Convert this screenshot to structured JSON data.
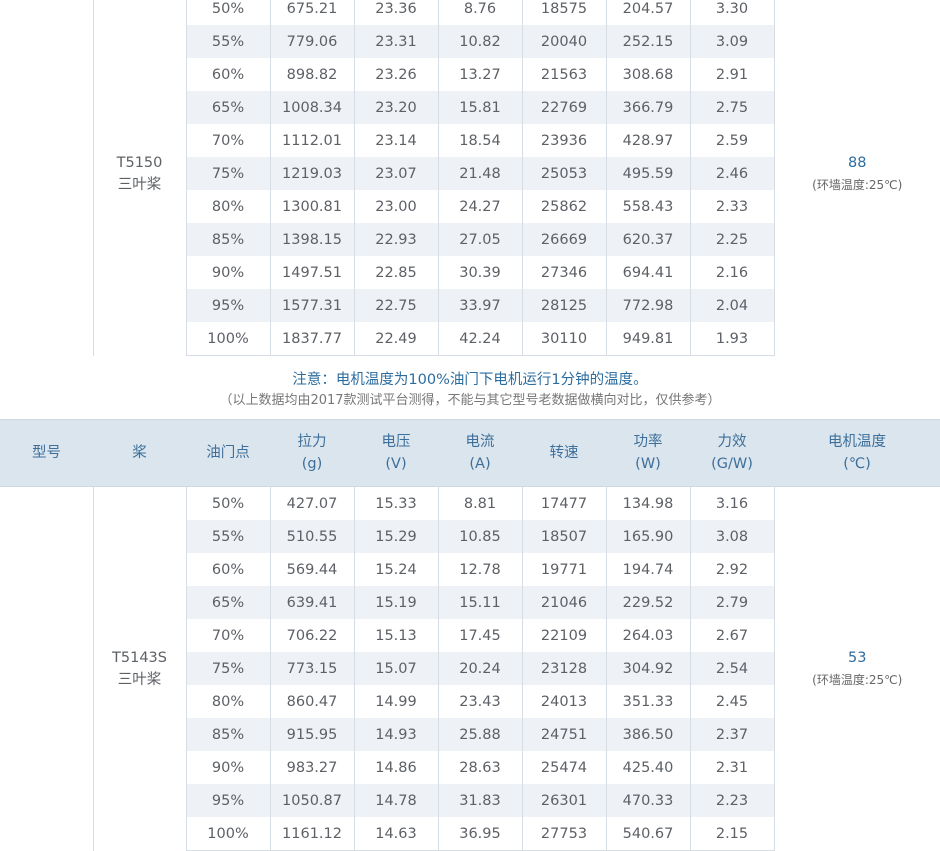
{
  "table1": {
    "model": "T5150",
    "prop": "三叶桨",
    "temp_value": "88",
    "temp_note": "(环墙温度:25℃)",
    "rows": [
      [
        "50%",
        "675.21",
        "23.36",
        "8.76",
        "18575",
        "204.57",
        "3.30"
      ],
      [
        "55%",
        "779.06",
        "23.31",
        "10.82",
        "20040",
        "252.15",
        "3.09"
      ],
      [
        "60%",
        "898.82",
        "23.26",
        "13.27",
        "21563",
        "308.68",
        "2.91"
      ],
      [
        "65%",
        "1008.34",
        "23.20",
        "15.81",
        "22769",
        "366.79",
        "2.75"
      ],
      [
        "70%",
        "1112.01",
        "23.14",
        "18.54",
        "23936",
        "428.97",
        "2.59"
      ],
      [
        "75%",
        "1219.03",
        "23.07",
        "21.48",
        "25053",
        "495.59",
        "2.46"
      ],
      [
        "80%",
        "1300.81",
        "23.00",
        "24.27",
        "25862",
        "558.43",
        "2.33"
      ],
      [
        "85%",
        "1398.15",
        "22.93",
        "27.05",
        "26669",
        "620.37",
        "2.25"
      ],
      [
        "90%",
        "1497.51",
        "22.85",
        "30.39",
        "27346",
        "694.41",
        "2.16"
      ],
      [
        "95%",
        "1577.31",
        "22.75",
        "33.97",
        "28125",
        "772.98",
        "2.04"
      ],
      [
        "100%",
        "1837.77",
        "22.49",
        "42.24",
        "30110",
        "949.81",
        "1.93"
      ]
    ]
  },
  "note": {
    "line1": "注意：电机温度为100%油门下电机运行1分钟的温度。",
    "line2": "（以上数据均由2017款测试平台测得，不能与其它型号老数据做横向对比，仅供参考）"
  },
  "header": {
    "model": "型号",
    "prop": "桨",
    "throttle": "油门点",
    "thrust": "拉力",
    "thrust_unit": "(g)",
    "voltage": "电压",
    "voltage_unit": "(V)",
    "current": "电流",
    "current_unit": "(A)",
    "rpm": "转速",
    "power": "功率",
    "power_unit": "(W)",
    "efficiency": "力效",
    "efficiency_unit": "(G/W)",
    "temp": "电机温度",
    "temp_unit": "(℃)"
  },
  "table2": {
    "model": "T5143S",
    "prop": "三叶桨",
    "temp_value": "53",
    "temp_note": "(环墙温度:25℃)",
    "rows": [
      [
        "50%",
        "427.07",
        "15.33",
        "8.81",
        "17477",
        "134.98",
        "3.16"
      ],
      [
        "55%",
        "510.55",
        "15.29",
        "10.85",
        "18507",
        "165.90",
        "3.08"
      ],
      [
        "60%",
        "569.44",
        "15.24",
        "12.78",
        "19771",
        "194.74",
        "2.92"
      ],
      [
        "65%",
        "639.41",
        "15.19",
        "15.11",
        "21046",
        "229.52",
        "2.79"
      ],
      [
        "70%",
        "706.22",
        "15.13",
        "17.45",
        "22109",
        "264.03",
        "2.67"
      ],
      [
        "75%",
        "773.15",
        "15.07",
        "20.24",
        "23128",
        "304.92",
        "2.54"
      ],
      [
        "80%",
        "860.47",
        "14.99",
        "23.43",
        "24013",
        "351.33",
        "2.45"
      ],
      [
        "85%",
        "915.95",
        "14.93",
        "25.88",
        "24751",
        "386.50",
        "2.37"
      ],
      [
        "90%",
        "983.27",
        "14.86",
        "28.63",
        "25474",
        "425.40",
        "2.31"
      ],
      [
        "95%",
        "1050.87",
        "14.78",
        "31.83",
        "26301",
        "470.33",
        "2.23"
      ],
      [
        "100%",
        "1161.12",
        "14.63",
        "36.95",
        "27753",
        "540.67",
        "2.15"
      ]
    ]
  }
}
